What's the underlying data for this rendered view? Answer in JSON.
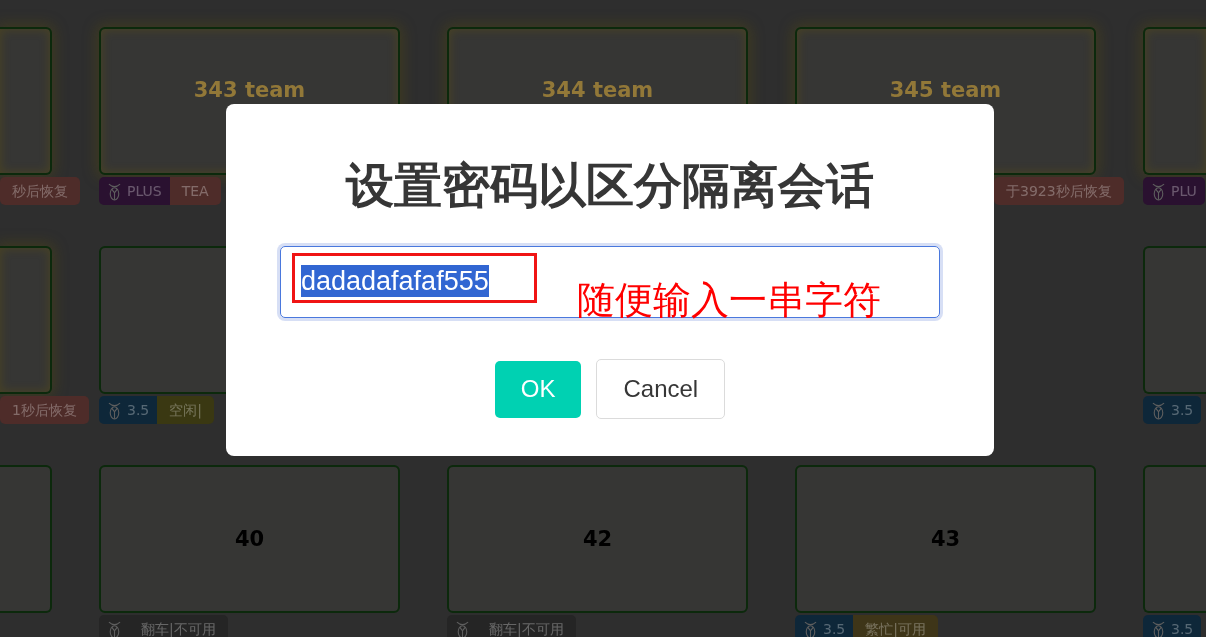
{
  "dashboard": {
    "rows": [
      {
        "cards": [
          {
            "highlighted": true,
            "badges": [
              {
                "kind": "status",
                "text": "秒后恢复",
                "color": "#4e2c29"
              }
            ]
          },
          {
            "title": "343 team",
            "highlighted": true,
            "badges": [
              {
                "kind": "plan",
                "text": "PLUS",
                "color": "#2a1130"
              },
              {
                "kind": "status",
                "text": "TEA",
                "color": "#4e2c29"
              }
            ]
          },
          {
            "title": "344 team",
            "highlighted": true
          },
          {
            "title": "345 team",
            "highlighted": true,
            "badges": [
              {
                "kind": "status",
                "text": "于3923秒后恢复",
                "color": "#4e2c29"
              }
            ]
          },
          {
            "highlighted": true,
            "badges": [
              {
                "kind": "plan",
                "text": "PLU",
                "color": "#2a1130"
              }
            ]
          }
        ]
      },
      {
        "cards": [
          {
            "highlighted": true,
            "badges": [
              {
                "kind": "status",
                "text": "1秒后恢复",
                "color": "#4e2c29"
              }
            ]
          },
          {
            "highlighted": false,
            "badges": [
              {
                "kind": "plan",
                "text": "3.5",
                "color": "#0e2739"
              },
              {
                "kind": "status",
                "text": "空闲|",
                "color": "#3a3812"
              }
            ]
          },
          {
            "highlighted": false,
            "badges": [
              {
                "kind": "plan",
                "text": "3.5",
                "color": "#0e2739"
              }
            ]
          }
        ]
      },
      {
        "cards": [
          {
            "highlighted": false
          },
          {
            "title": "40",
            "highlighted": false,
            "badges": [
              {
                "kind": "plan",
                "color": "#252525"
              },
              {
                "kind": "status",
                "text": "翻车|不可用",
                "color": "#252525"
              }
            ]
          },
          {
            "title": "42",
            "highlighted": false,
            "badges": [
              {
                "kind": "plan",
                "color": "#252525"
              },
              {
                "kind": "status",
                "text": "翻车|不可用",
                "color": "#252525"
              }
            ]
          },
          {
            "title": "43",
            "highlighted": false,
            "badges": [
              {
                "kind": "plan",
                "text": "3.5",
                "color": "#0e2739"
              },
              {
                "kind": "status",
                "text": "繁忙|可用",
                "color": "#3e3518"
              }
            ]
          },
          {
            "highlighted": false,
            "badges": [
              {
                "kind": "plan",
                "text": "3.5",
                "color": "#0e2739"
              }
            ]
          }
        ]
      }
    ]
  },
  "dialog": {
    "title": "设置密码以区分隔离会话",
    "input": {
      "value": "dadadafafaf555",
      "focused": true,
      "value_selected": true
    },
    "buttons": [
      {
        "kind": "primary",
        "label": "OK"
      },
      {
        "kind": "default",
        "label": "Cancel"
      }
    ]
  },
  "annotation": {
    "note": "随便输入一串字符",
    "outline_value": true
  }
}
